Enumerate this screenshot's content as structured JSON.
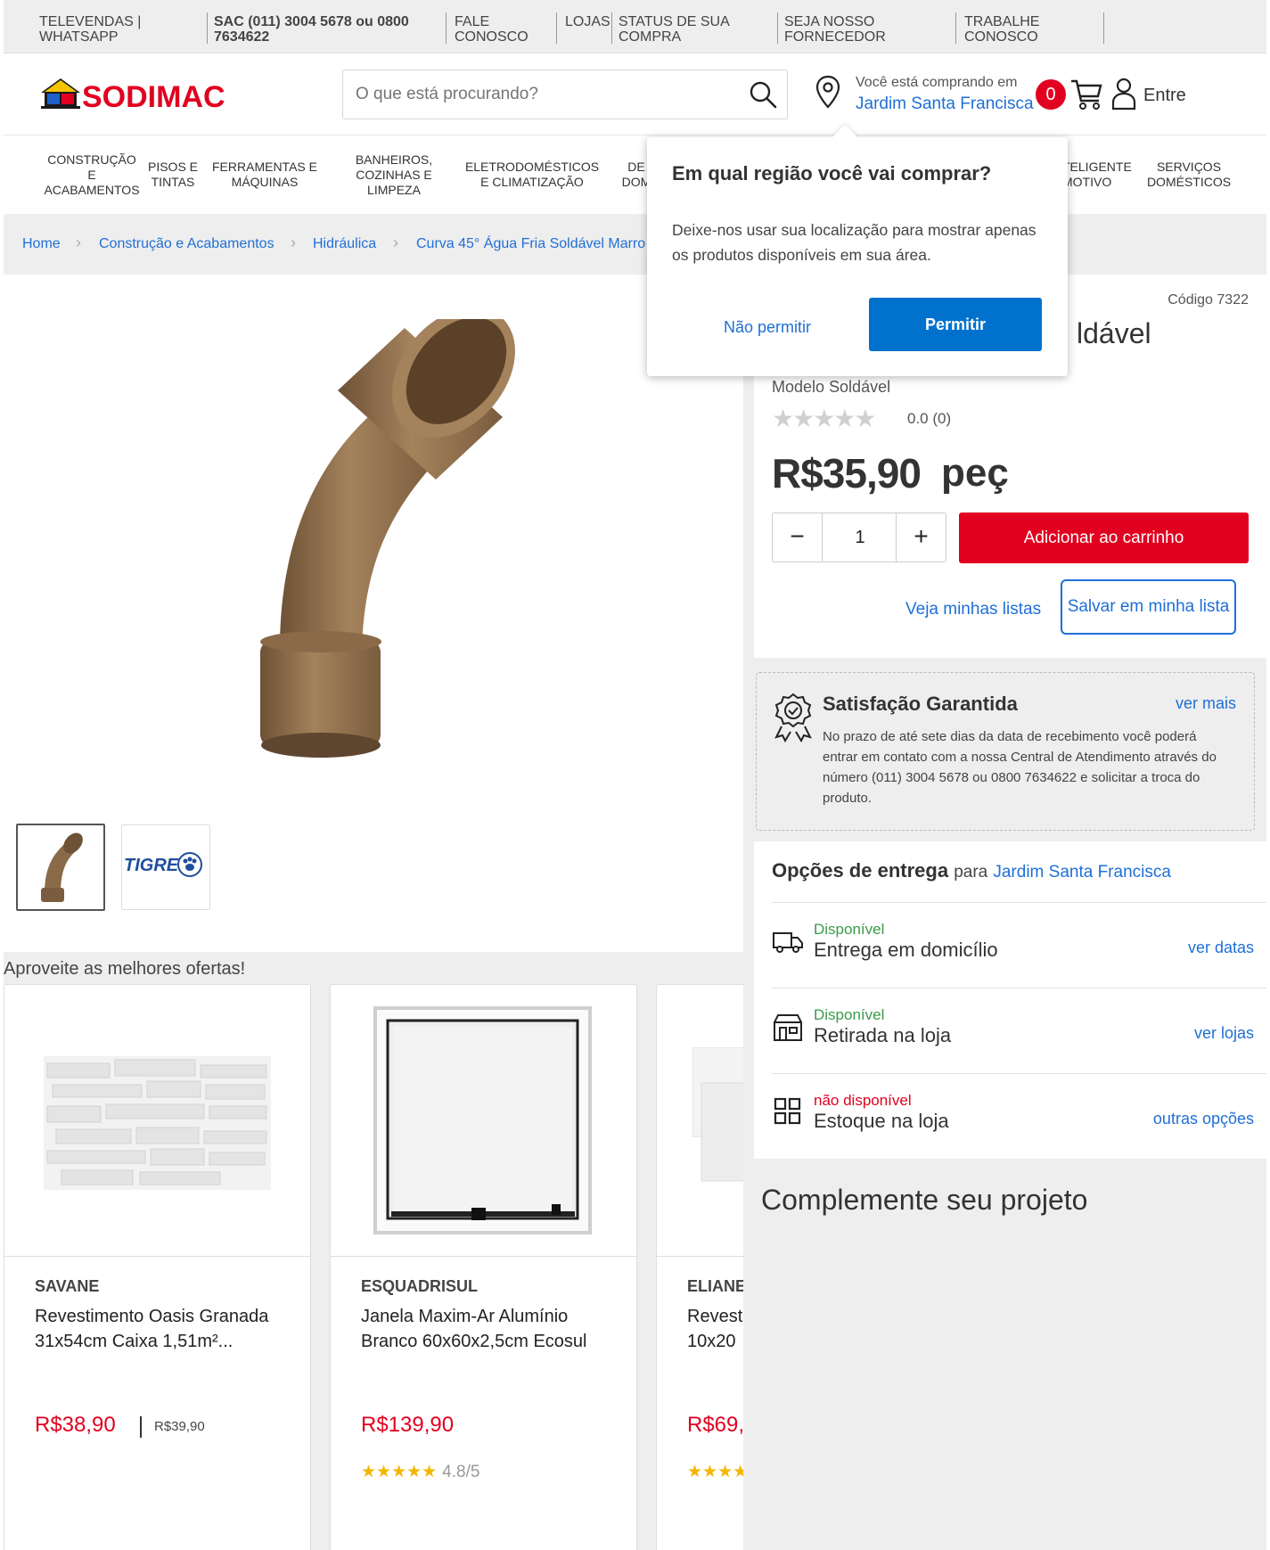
{
  "topbar": {
    "items": [
      "TELEVENDAS | WHATSAPP",
      "SAC (011) 3004 5678 ou 0800 7634622",
      "FALE CONOSCO",
      "LOJAS",
      "STATUS DE SUA COMPRA",
      "SEJA NOSSO FORNECEDOR",
      "TRABALHE CONOSCO"
    ]
  },
  "header": {
    "logo_text": "SODIMAC",
    "search_placeholder": "O que está procurando?",
    "location_label": "Você está comprando em",
    "location_city": "Jardim Santa Francisca",
    "cart_count": "0",
    "login_label": "Entre"
  },
  "nav": {
    "items": [
      "CONSTRUÇÃO E ACABAMENTOS",
      "PISOS E TINTAS",
      "FERRAMENTAS E MÁQUINAS",
      "BANHEIROS, COZINHAS E LIMPEZA",
      "ELETRODOMÉSTICOS E CLIMATIZAÇÃO",
      "DE DOM",
      "TELIGENTE MOTIVO",
      "SERVIÇOS DOMÉSTICOS"
    ]
  },
  "breadcrumb": [
    "Home",
    "Construção e Acabamentos",
    "Hidráulica",
    "Curva 45° Água Fria Soldável Marro"
  ],
  "product": {
    "code": "Código 7322",
    "title_visible": "ldável",
    "model": "Modelo Soldável",
    "rating": "0.0",
    "reviews": "(0)",
    "price": "R$35,90",
    "unit": "peç",
    "qty": "1",
    "add_to_cart": "Adicionar ao carrinho",
    "my_lists": "Veja minhas listas",
    "save_list": "Salvar em minha lista",
    "thumb2_brand": "TIGRE"
  },
  "popup": {
    "title": "Em qual região você vai comprar?",
    "desc": "Deixe-nos usar sua localização para mostrar apenas os produtos disponíveis em sua área.",
    "deny": "Não permitir",
    "allow": "Permitir"
  },
  "satisfaction": {
    "title": "Satisfação Garantida",
    "see_more": "ver mais",
    "text": "No prazo de até sete dias da data de recebimento você poderá entrar em contato com a nossa Central de Atendimento através do número (011) 3004 5678 ou 0800 7634622 e solicitar a troca do produto."
  },
  "delivery": {
    "title": "Opções de entrega",
    "for": "para",
    "city": "Jardim Santa Francisca",
    "rows": [
      {
        "status": "Disponível",
        "name": "Entrega em domicílio",
        "link": "ver datas"
      },
      {
        "status": "Disponível",
        "name": "Retirada na loja",
        "link": "ver lojas"
      },
      {
        "status": "não disponível",
        "name": "Estoque na loja",
        "link": "outras opções"
      }
    ]
  },
  "complement_title": "Complemente seu projeto",
  "offers": {
    "title": "Aproveite as melhores ofertas!",
    "cards": [
      {
        "brand": "SAVANE",
        "name": "Revestimento Oasis Granada 31x54cm Caixa 1,51m²...",
        "price": "R$38,90",
        "old_price": "R$39,90",
        "rating": ""
      },
      {
        "brand": "ESQUADRISUL",
        "name": "Janela Maxim-Ar Alumínio Branco 60x60x2,5cm Ecosul",
        "price": "R$139,90",
        "old_price": "",
        "rating": "4.8/5"
      },
      {
        "brand": "ELIANE",
        "name": "Revest 10x20",
        "price": "R$69,",
        "old_price": "",
        "rating": ""
      }
    ]
  },
  "colors": {
    "brand_red": "#e1001f",
    "link_blue": "#1f6fd6",
    "allow_blue": "#0072ce",
    "available_green": "#3a9a4a"
  }
}
